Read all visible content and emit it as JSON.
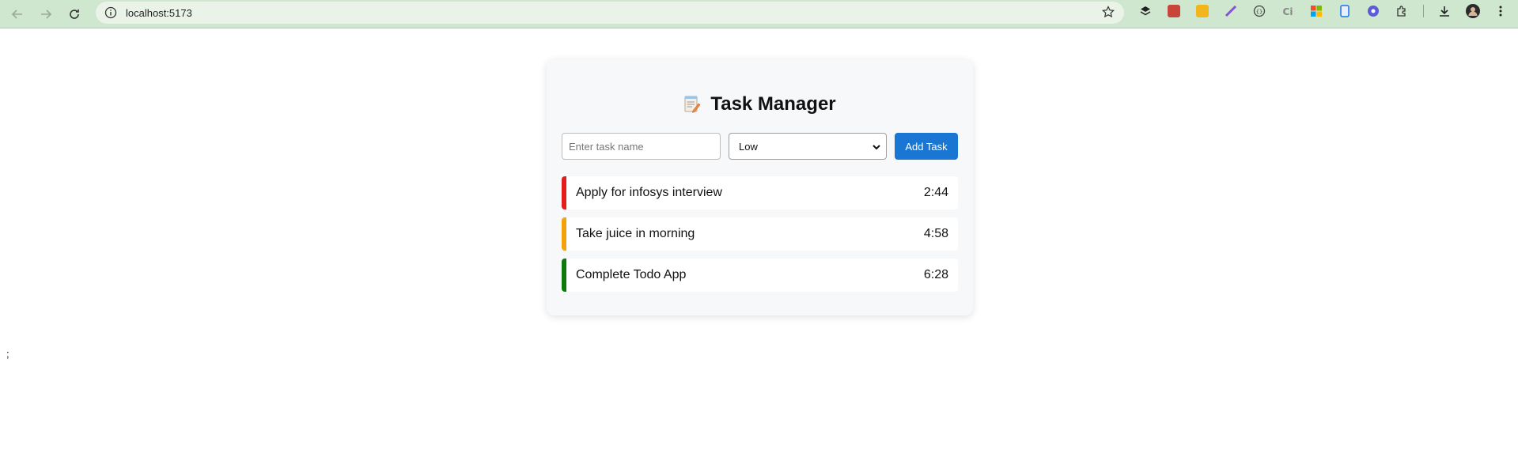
{
  "browser": {
    "url": "localhost:5173",
    "icons": [
      "back-arrow-icon",
      "forward-arrow-icon",
      "reload-icon",
      "site-info-icon",
      "bookmark-star-icon",
      "downloads-icon",
      "profile-avatar-icon",
      "menu-kebab-icon"
    ]
  },
  "app": {
    "title": "Task Manager",
    "title_icon": "memo-icon"
  },
  "form": {
    "placeholder": "Enter task name",
    "input_value": "",
    "priority_selected": "Low",
    "add_label": "Add Task"
  },
  "tasks": [
    {
      "name": "Apply for infosys interview",
      "time": "2:44",
      "color": "#e51c1c"
    },
    {
      "name": "Take juice in morning",
      "time": "4:58",
      "color": "#f4a20c"
    },
    {
      "name": "Complete Todo App",
      "time": "6:28",
      "color": "#0b7a0b"
    }
  ],
  "stray_text": ";",
  "colors": {
    "accent": "#1976d2",
    "toolbar": "#cfe6cf"
  }
}
